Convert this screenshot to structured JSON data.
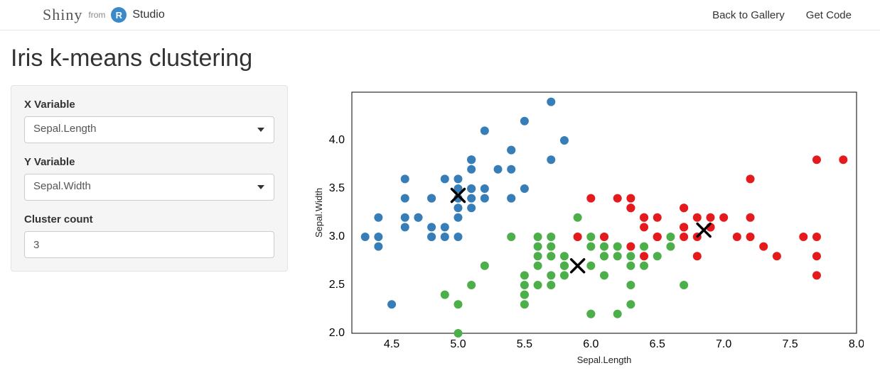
{
  "header": {
    "brand_shiny": "Shiny",
    "brand_from": "from",
    "brand_r": "R",
    "brand_studio": "Studio",
    "link_gallery": "Back to Gallery",
    "link_code": "Get Code"
  },
  "title": "Iris k-means clustering",
  "sidebar": {
    "xvar_label": "X Variable",
    "xvar_value": "Sepal.Length",
    "yvar_label": "Y Variable",
    "yvar_value": "Sepal.Width",
    "clusters_label": "Cluster count",
    "clusters_value": "3"
  },
  "chart_data": {
    "type": "scatter",
    "xlabel": "Sepal.Length",
    "ylabel": "Sepal.Width",
    "xlim": [
      4.2,
      8.0
    ],
    "ylim": [
      2.0,
      4.5
    ],
    "xticks": [
      4.5,
      5.0,
      5.5,
      6.0,
      6.5,
      7.0,
      7.5,
      8.0
    ],
    "yticks": [
      2.0,
      2.5,
      3.0,
      3.5,
      4.0
    ],
    "colors": {
      "1": "#e41a1c",
      "2": "#377eb8",
      "3": "#4daf4a"
    },
    "centroids": [
      {
        "cluster": 2,
        "x": 5.0,
        "y": 3.43
      },
      {
        "cluster": 3,
        "x": 5.9,
        "y": 2.7
      },
      {
        "cluster": 1,
        "x": 6.85,
        "y": 3.07
      }
    ],
    "series": [
      {
        "name": "cluster-2",
        "cluster": 2,
        "points": [
          [
            4.3,
            3.0
          ],
          [
            4.4,
            2.9
          ],
          [
            4.4,
            3.0
          ],
          [
            4.4,
            3.2
          ],
          [
            4.5,
            2.3
          ],
          [
            4.6,
            3.1
          ],
          [
            4.6,
            3.4
          ],
          [
            4.6,
            3.2
          ],
          [
            4.6,
            3.6
          ],
          [
            4.7,
            3.2
          ],
          [
            4.7,
            3.2
          ],
          [
            4.8,
            3.4
          ],
          [
            4.8,
            3.0
          ],
          [
            4.8,
            3.4
          ],
          [
            4.8,
            3.1
          ],
          [
            4.8,
            3.0
          ],
          [
            4.9,
            3.0
          ],
          [
            4.9,
            3.1
          ],
          [
            4.9,
            3.6
          ],
          [
            5.0,
            3.6
          ],
          [
            5.0,
            3.4
          ],
          [
            5.0,
            3.0
          ],
          [
            5.0,
            3.4
          ],
          [
            5.0,
            3.2
          ],
          [
            5.0,
            3.5
          ],
          [
            5.0,
            3.3
          ],
          [
            5.1,
            3.5
          ],
          [
            5.1,
            3.5
          ],
          [
            5.1,
            3.8
          ],
          [
            5.1,
            3.7
          ],
          [
            5.1,
            3.3
          ],
          [
            5.1,
            3.4
          ],
          [
            5.1,
            3.8
          ],
          [
            5.1,
            3.8
          ],
          [
            5.2,
            3.5
          ],
          [
            5.2,
            3.4
          ],
          [
            5.2,
            4.1
          ],
          [
            5.3,
            3.7
          ],
          [
            5.4,
            3.9
          ],
          [
            5.4,
            3.7
          ],
          [
            5.4,
            3.4
          ],
          [
            5.4,
            3.9
          ],
          [
            5.4,
            3.4
          ],
          [
            5.5,
            4.2
          ],
          [
            5.5,
            3.5
          ],
          [
            5.7,
            4.4
          ],
          [
            5.7,
            3.8
          ],
          [
            5.8,
            4.0
          ]
        ]
      },
      {
        "name": "cluster-3",
        "cluster": 3,
        "points": [
          [
            4.9,
            2.4
          ],
          [
            5.0,
            2.0
          ],
          [
            5.0,
            2.3
          ],
          [
            5.1,
            2.5
          ],
          [
            5.2,
            2.7
          ],
          [
            5.4,
            3.0
          ],
          [
            5.5,
            2.3
          ],
          [
            5.5,
            2.4
          ],
          [
            5.5,
            2.4
          ],
          [
            5.5,
            2.5
          ],
          [
            5.5,
            2.6
          ],
          [
            5.6,
            2.9
          ],
          [
            5.6,
            3.0
          ],
          [
            5.6,
            2.5
          ],
          [
            5.6,
            2.7
          ],
          [
            5.6,
            2.8
          ],
          [
            5.7,
            2.8
          ],
          [
            5.7,
            2.6
          ],
          [
            5.7,
            3.0
          ],
          [
            5.7,
            2.9
          ],
          [
            5.7,
            2.8
          ],
          [
            5.7,
            2.5
          ],
          [
            5.8,
            2.7
          ],
          [
            5.8,
            2.7
          ],
          [
            5.8,
            2.8
          ],
          [
            5.8,
            2.6
          ],
          [
            5.8,
            2.7
          ],
          [
            5.9,
            3.0
          ],
          [
            5.9,
            3.2
          ],
          [
            6.0,
            2.2
          ],
          [
            6.0,
            2.9
          ],
          [
            6.0,
            2.7
          ],
          [
            6.0,
            3.0
          ],
          [
            6.0,
            2.2
          ],
          [
            6.1,
            2.9
          ],
          [
            6.1,
            2.8
          ],
          [
            6.1,
            2.8
          ],
          [
            6.1,
            2.6
          ],
          [
            6.1,
            3.0
          ],
          [
            6.2,
            2.2
          ],
          [
            6.2,
            2.9
          ],
          [
            6.2,
            2.8
          ],
          [
            6.3,
            2.5
          ],
          [
            6.3,
            2.3
          ],
          [
            6.3,
            2.7
          ],
          [
            6.3,
            2.8
          ],
          [
            6.4,
            2.9
          ],
          [
            6.4,
            2.7
          ],
          [
            6.5,
            2.8
          ],
          [
            6.6,
            2.9
          ],
          [
            6.6,
            3.0
          ],
          [
            6.7,
            2.5
          ]
        ]
      },
      {
        "name": "cluster-1",
        "cluster": 1,
        "points": [
          [
            5.9,
            3.0
          ],
          [
            6.0,
            3.4
          ],
          [
            6.1,
            3.0
          ],
          [
            6.2,
            3.4
          ],
          [
            6.3,
            3.3
          ],
          [
            6.3,
            2.9
          ],
          [
            6.3,
            3.4
          ],
          [
            6.3,
            3.3
          ],
          [
            6.4,
            3.2
          ],
          [
            6.4,
            3.2
          ],
          [
            6.4,
            2.8
          ],
          [
            6.4,
            3.1
          ],
          [
            6.5,
            3.0
          ],
          [
            6.5,
            3.2
          ],
          [
            6.5,
            3.0
          ],
          [
            6.5,
            3.0
          ],
          [
            6.7,
            3.1
          ],
          [
            6.7,
            3.0
          ],
          [
            6.7,
            3.1
          ],
          [
            6.7,
            3.3
          ],
          [
            6.7,
            3.1
          ],
          [
            6.7,
            3.3
          ],
          [
            6.8,
            2.8
          ],
          [
            6.8,
            3.0
          ],
          [
            6.8,
            3.2
          ],
          [
            6.9,
            3.1
          ],
          [
            6.9,
            3.2
          ],
          [
            6.9,
            3.1
          ],
          [
            6.9,
            3.1
          ],
          [
            7.0,
            3.2
          ],
          [
            7.1,
            3.0
          ],
          [
            7.2,
            3.6
          ],
          [
            7.2,
            3.2
          ],
          [
            7.2,
            3.0
          ],
          [
            7.3,
            2.9
          ],
          [
            7.4,
            2.8
          ],
          [
            7.6,
            3.0
          ],
          [
            7.7,
            3.8
          ],
          [
            7.7,
            2.6
          ],
          [
            7.7,
            2.8
          ],
          [
            7.7,
            3.0
          ],
          [
            7.9,
            3.8
          ]
        ]
      }
    ]
  }
}
